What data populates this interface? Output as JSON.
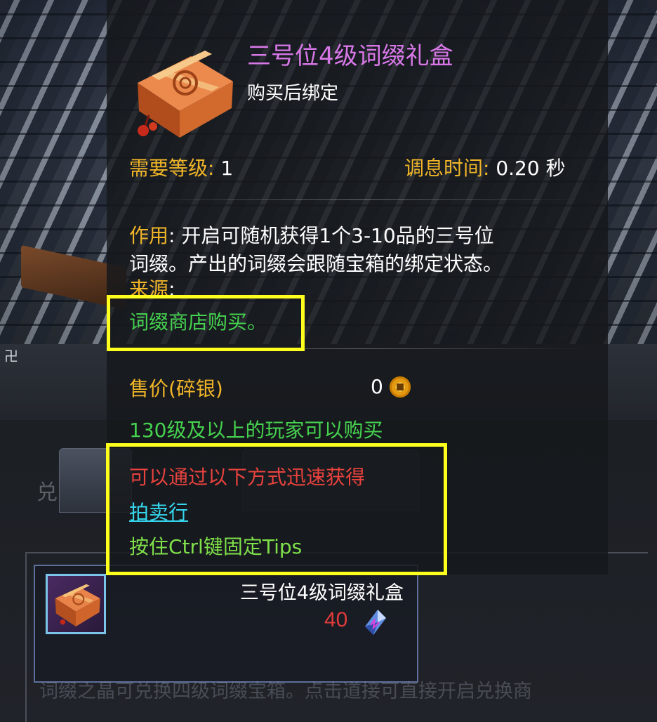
{
  "tooltip": {
    "title": "三号位4级词缀礼盒",
    "bind_text": "购买后绑定",
    "level_label": "需要等级:",
    "level_value": "1",
    "cooldown_label": "调息时间:",
    "cooldown_value": "0.20 秒",
    "effect_label": "作用",
    "effect_sep": ":",
    "effect_line1": "开启可随机获得1个3-10品的三号位",
    "effect_line2": "词缀。产出的词缀会跟随宝箱的绑定状态。",
    "source_label": "来源",
    "source_sep": ":",
    "source_text": "词缀商店购买。",
    "price_label": "售价(碎银)",
    "price_value": "0",
    "level_requirement": "130级及以上的玩家可以购买",
    "quick_get_title": "可以通过以下方式迅速获得",
    "auction_link": "拍卖行",
    "ctrl_tip": "按住Ctrl键固定Tips"
  },
  "shop": {
    "item_name": "三号位4级词缀礼盒",
    "item_price": "40",
    "footer_text": "词缀之晶可兑换四级词缀宝箱。点击道接可直接开启兑换商",
    "corner_glyph": "卍"
  },
  "icons": {
    "gift_box": "gift-box-icon",
    "coin": "silver-coin-icon",
    "gem": "crystal-gem-icon"
  },
  "colors": {
    "title": "#d878e8",
    "gold_label": "#f1b528",
    "green": "#45d14f",
    "red": "#e8423e",
    "link": "#35d7ee",
    "highlight": "#ffff1e"
  }
}
